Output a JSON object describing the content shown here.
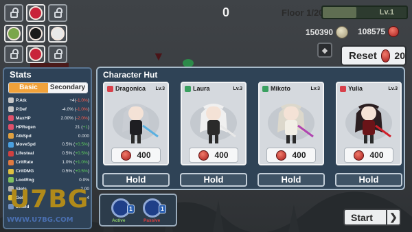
{
  "hud": {
    "counter": "0",
    "floor": "Floor 1/20",
    "level_label": "Lv.1",
    "level_progress": 0.4,
    "gold": "150390",
    "gems": "108575",
    "reset_label": "Reset",
    "reset_cost": "20"
  },
  "party_slots": [
    {
      "type": "locked"
    },
    {
      "type": "hero",
      "color": "#c8243a"
    },
    {
      "type": "locked"
    },
    {
      "type": "hero",
      "color": "#7aa64a"
    },
    {
      "type": "hero",
      "color": "#1b1b1b"
    },
    {
      "type": "hero",
      "color": "#e8e8e8"
    },
    {
      "type": "locked"
    },
    {
      "type": "hero",
      "color": "#c8243a"
    },
    {
      "type": "locked"
    }
  ],
  "stats": {
    "title": "Stats",
    "tab_basic": "Basic",
    "tab_secondary": "Secondary",
    "rows": [
      {
        "name": "P.Atk",
        "value": "+4(",
        "delta": "-1.0%",
        "delta_sign": "neg",
        "suffix": ")",
        "icon_color": "#c7c7c7"
      },
      {
        "name": "P.Def",
        "value": "-4.0% (",
        "delta": "-1.0%",
        "delta_sign": "neg",
        "suffix": ")",
        "icon_color": "#c7c7c7"
      },
      {
        "name": "MaxHP",
        "value": "2.00% (",
        "delta": "-2.0%",
        "delta_sign": "neg",
        "suffix": ")",
        "icon_color": "#e0506a"
      },
      {
        "name": "HPRegen",
        "value": "21 (",
        "delta": "+1",
        "delta_sign": "pos",
        "suffix": ")",
        "icon_color": "#e0506a"
      },
      {
        "name": "AtkSpd",
        "value": "0.000",
        "delta": "",
        "delta_sign": "",
        "suffix": "",
        "icon_color": "#e0a040"
      },
      {
        "name": "MoveSpd",
        "value": "0.5% (",
        "delta": "+0.5%",
        "delta_sign": "pos",
        "suffix": ")",
        "icon_color": "#4aa0e0"
      },
      {
        "name": "Lifesteal",
        "value": "0.5% (",
        "delta": "+0.5%",
        "delta_sign": "pos",
        "suffix": ")",
        "icon_color": "#d04040"
      },
      {
        "name": "CritRate",
        "value": "1.0% (",
        "delta": "+1.0%",
        "delta_sign": "pos",
        "suffix": ")",
        "icon_color": "#e07a40"
      },
      {
        "name": "CritDMG",
        "value": "0.5% (",
        "delta": "+0.5%",
        "delta_sign": "pos",
        "suffix": ")",
        "icon_color": "#e0c040"
      },
      {
        "name": "LootRng",
        "value": "0.0%",
        "delta": "",
        "delta_sign": "",
        "suffix": "",
        "icon_color": "#80c060"
      },
      {
        "name": "Slots",
        "value": "2.00",
        "delta": "",
        "delta_sign": "",
        "suffix": "",
        "icon_color": "#b0b0b0"
      },
      {
        "name": "Gold",
        "value": "4",
        "delta": "",
        "delta_sign": "",
        "suffix": "",
        "icon_color": "#e0c040"
      },
      {
        "name": "Shield",
        "value": "",
        "delta": "",
        "delta_sign": "",
        "suffix": "",
        "icon_color": "#7090c0"
      }
    ]
  },
  "hut": {
    "title": "Character Hut",
    "hold_label": "Hold",
    "characters": [
      {
        "name": "Dragonica",
        "level": "Lv.3",
        "price": "400",
        "element_color": "#d8404a",
        "hair": "#c9cdd3",
        "outfit": "#1e1e22",
        "accent": "#5ab0e0"
      },
      {
        "name": "Laura",
        "level": "Lv.3",
        "price": "400",
        "element_color": "#3aa060",
        "hair": "#f0f0f0",
        "outfit": "#2a2a2a",
        "accent": "#e8e8e8"
      },
      {
        "name": "Mikoto",
        "level": "Lv.3",
        "price": "400",
        "element_color": "#3aa060",
        "hair": "#dcd8cc",
        "outfit": "#f2efe6",
        "accent": "#b044b0"
      },
      {
        "name": "Yulia",
        "level": "Lv.3",
        "price": "400",
        "element_color": "#d8404a",
        "hair": "#2a1e20",
        "outfit": "#6a1418",
        "accent": "#d0202a"
      }
    ]
  },
  "skills": {
    "items": [
      {
        "tag": "Active",
        "tag_color": "#8fd06a",
        "badge": "1"
      },
      {
        "tag": "Passive",
        "tag_color": "#e04040",
        "badge": "1"
      }
    ]
  },
  "start_label": "Start",
  "watermark": {
    "logo": "U7BG",
    "url": "WWW.U7BG.COM"
  }
}
